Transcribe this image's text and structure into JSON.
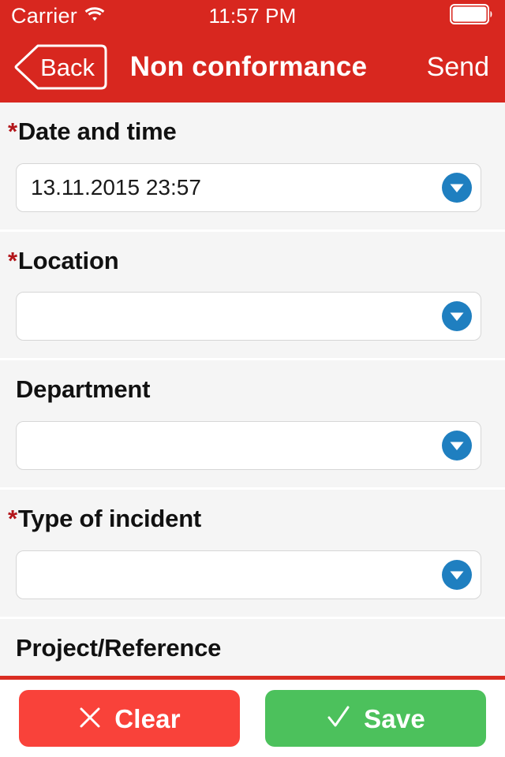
{
  "status_bar": {
    "carrier": "Carrier",
    "wifi_icon": "wifi-icon",
    "time": "11:57 PM",
    "battery_icon": "battery-full-icon"
  },
  "nav_bar": {
    "back_label": "Back",
    "back_icon": "chevron-left-icon",
    "title": "Non conformance",
    "send_label": "Send"
  },
  "form": {
    "required_marker": "*",
    "dropdown_icon": "chevron-down-circle-icon",
    "fields": [
      {
        "label": "Date and time",
        "required": true,
        "value": "13.11.2015 23:57",
        "placeholder": "",
        "has_dropdown": true
      },
      {
        "label": "Location",
        "required": true,
        "value": "",
        "placeholder": "",
        "has_dropdown": true
      },
      {
        "label": "Department",
        "required": false,
        "value": "",
        "placeholder": "",
        "has_dropdown": true
      },
      {
        "label": "Type of incident",
        "required": true,
        "value": "",
        "placeholder": "",
        "has_dropdown": true
      },
      {
        "label": "Project/Reference",
        "required": false,
        "value": "",
        "placeholder": "",
        "has_dropdown": true
      }
    ]
  },
  "action_bar": {
    "clear_label": "Clear",
    "clear_icon": "close-x-icon",
    "save_label": "Save",
    "save_icon": "checkmark-icon"
  },
  "colors": {
    "header_red": "#d8271f",
    "divider_red": "#da2d22",
    "clear_red": "#f9423a",
    "save_green": "#4cc15c",
    "dropdown_blue": "#1f7fc0",
    "required_star": "#b3161b",
    "page_background": "#f5f5f5"
  }
}
